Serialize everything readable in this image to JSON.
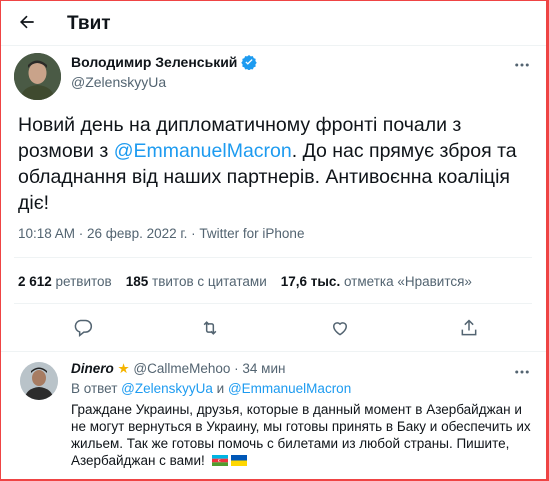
{
  "header": {
    "title": "Твит",
    "back_icon": "arrow-left-icon"
  },
  "author": {
    "name": "Володимир Зеленський",
    "handle": "@ZelenskyyUa",
    "verified": true
  },
  "tweet": {
    "text_before": "Новий день на дипломатичному фронті почали з розмови з ",
    "mention": "@EmmanuelMacron",
    "text_after": ". До нас прямує зброя та обладнання від наших партнерів. Антивоєнна коаліція діє!",
    "meta": "10:18 AM · 26 февр. 2022 г. · Twitter for iPhone"
  },
  "stats": {
    "retweets_count": "2 612",
    "retweets_label": " ретвитов",
    "quotes_count": "185",
    "quotes_label": " твитов с цитатами",
    "likes_count": "17,6 тыс.",
    "likes_label": " отметка «Нравится»"
  },
  "reply": {
    "name": "Dinero",
    "handle": "@CallmeMehoo",
    "time": "· 34 мин",
    "in_reply_prefix": "В ответ ",
    "in_reply_user1": "@ZelenskyyUa",
    "in_reply_and": " и ",
    "in_reply_user2": "@EmmanuelMacron",
    "text": "Граждане Украины, друзья, которые в данный момент в Азербайджан и не могут вернуться в Украину, мы готовы принять в Баку и обеспечить их жильем. Так же готовы помочь с билетами из любой страны. Пишите, Азербайджан с вами!"
  },
  "colors": {
    "accent": "#1d9bf0",
    "text": "#0f1419",
    "muted": "#536471",
    "frame": "#ef4444"
  }
}
